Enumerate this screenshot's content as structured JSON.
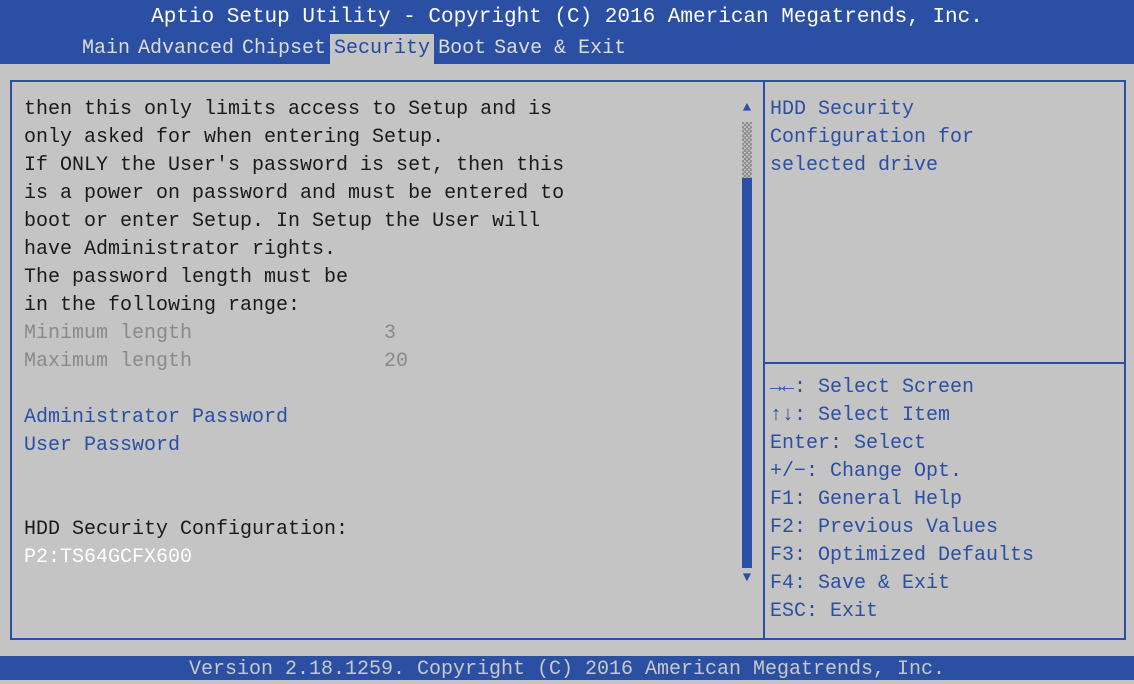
{
  "header": {
    "title": "Aptio Setup Utility - Copyright (C) 2016 American Megatrends, Inc."
  },
  "tabs": [
    {
      "label": "Main"
    },
    {
      "label": "Advanced"
    },
    {
      "label": "Chipset"
    },
    {
      "label": "Security",
      "active": true
    },
    {
      "label": "Boot"
    },
    {
      "label": "Save & Exit"
    }
  ],
  "main": {
    "description": [
      "then this only limits access to Setup and is",
      "only asked for when entering Setup.",
      "If ONLY the User's password is set, then this",
      "is a power on password and must be entered to",
      "boot or enter Setup. In Setup the User will",
      "have Administrator rights.",
      "The password length must be",
      "in the following range:"
    ],
    "min_length": {
      "label": "Minimum length",
      "value": "3"
    },
    "max_length": {
      "label": "Maximum length",
      "value": "20"
    },
    "admin_password": "Administrator Password",
    "user_password": "User Password",
    "hdd_heading": "HDD Security Configuration:",
    "hdd_drive": "P2:TS64GCFX600"
  },
  "help": {
    "description": [
      "HDD Security",
      "Configuration for",
      "selected drive"
    ],
    "keys": [
      "→←: Select Screen",
      "↑↓: Select Item",
      "Enter: Select",
      "+/−: Change Opt.",
      "F1: General Help",
      "F2: Previous Values",
      "F3: Optimized Defaults",
      "F4: Save & Exit",
      "ESC: Exit"
    ]
  },
  "footer": {
    "text": "Version 2.18.1259. Copyright (C) 2016 American Megatrends, Inc."
  },
  "colors": {
    "background": "#c4c4c4",
    "accent_blue": "#2a4fa3",
    "header_text": "#ffffff",
    "disabled_text": "#8a8a8a"
  },
  "icons": {
    "scroll_up": "triangle-up",
    "scroll_down": "triangle-down"
  }
}
